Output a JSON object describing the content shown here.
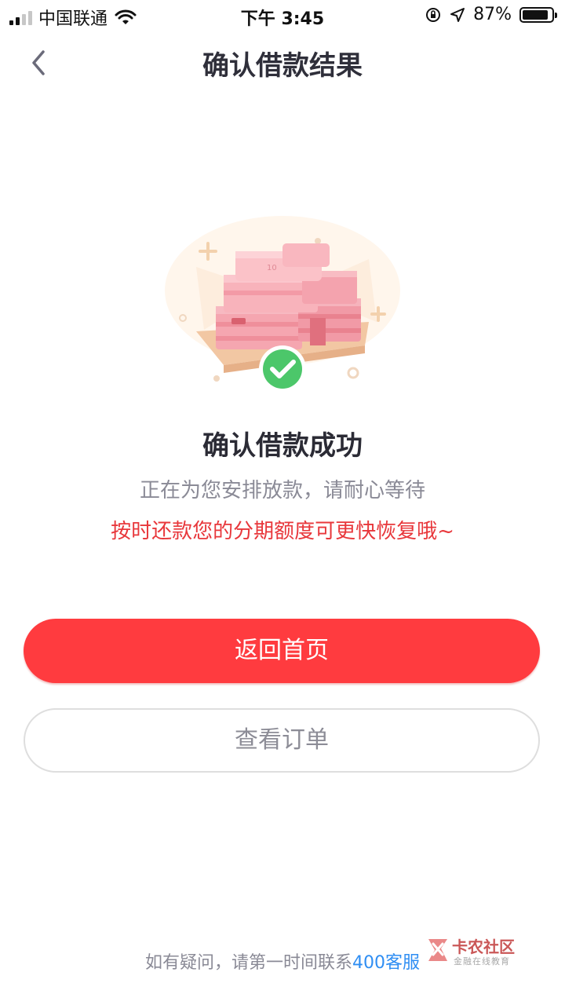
{
  "status_bar": {
    "carrier": "中国联通",
    "time": "下午 3:45",
    "battery": "87%",
    "battery_level": 0.87,
    "icons": [
      "signal-icon",
      "wifi-icon",
      "orientation-lock-icon",
      "location-icon",
      "battery-icon"
    ]
  },
  "nav": {
    "title": "确认借款结果",
    "back_icon": "chevron-left-icon"
  },
  "result": {
    "title": "确认借款成功",
    "subtitle": "正在为您安排放款，请耐心等待",
    "tip": "按时还款您的分期额度可更快恢复哦~",
    "illustration": "money-stack-with-check-icon"
  },
  "buttons": {
    "primary": "返回首页",
    "secondary": "查看订单"
  },
  "footer": {
    "prefix": "如有疑问，请第一时间联系",
    "link": "400客服"
  },
  "watermark": {
    "name": "卡农社区",
    "tagline": "金融在线教育"
  },
  "colors": {
    "accent": "#ff3b3f",
    "tip": "#e8373b",
    "link": "#2f8ef3",
    "success": "#4cc76a"
  }
}
